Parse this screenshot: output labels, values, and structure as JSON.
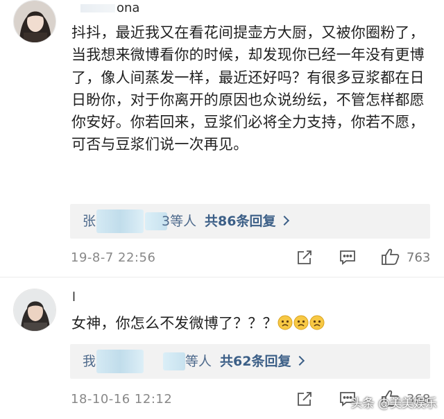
{
  "comments": [
    {
      "username_visible": "ona",
      "text": "抖抖，最近我又在看花间提壶方大厨，又被你圈粉了，当我想来微博看你的时候，却发现你已经一年没有更博了，像人间蒸发一样，最近还好吗？有很多豆浆都在日日盼你，对于你离开的原因也众说纷纭，不管怎样都愿你安好。你若回来，豆浆们必将全力支持，你若不愿，可否与豆浆们说一次再见。",
      "reply_prefix": "张",
      "reply_suffix": "3等人",
      "reply_count": "共86条回复",
      "timestamp": "19-8-7 22:56",
      "likes": "763"
    },
    {
      "username_visible": "l",
      "text": "女神，你怎么不发微博了？？？",
      "reply_prefix": "我",
      "reply_suffix": "等人",
      "reply_count": "共62条回复",
      "timestamp": "18-10-16 12:12",
      "likes": "368"
    }
  ],
  "icons": {
    "share": "share-icon",
    "comment": "comment-icon",
    "like": "thumbs-up-icon",
    "emoji": "worried-face-emoji"
  },
  "watermark": "头条 @美美娱乐",
  "colors": {
    "reply_link": "#3c5f87",
    "reply_bg": "#f2f2f2",
    "timestamp": "#888888"
  }
}
